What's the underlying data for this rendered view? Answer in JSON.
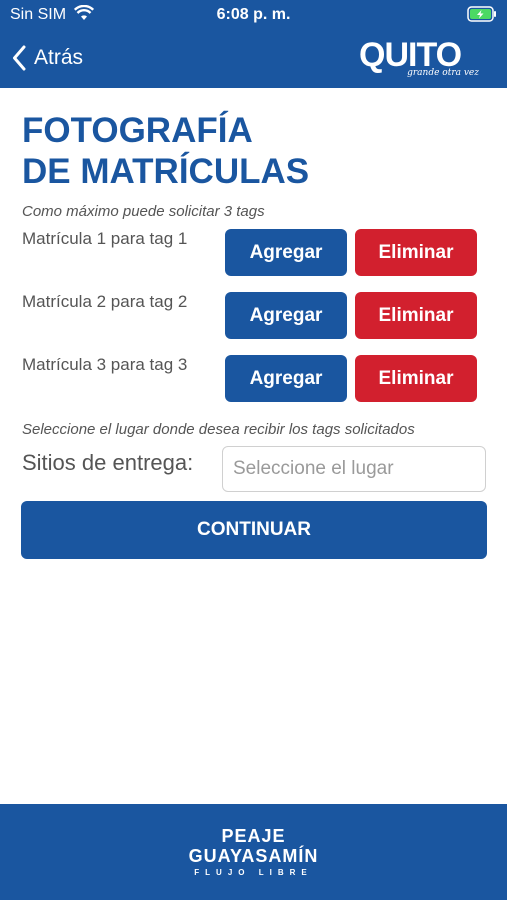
{
  "status_bar": {
    "carrier": "Sin SIM",
    "time": "6:08 p. m."
  },
  "nav": {
    "back_label": "Atrás"
  },
  "logo": {
    "word": "QUITO",
    "tagline": "grande otra vez"
  },
  "page": {
    "title_line1": "FOTOGRAFÍA",
    "title_line2": "DE MATRÍCULAS",
    "limit_note": "Como máximo puede solicitar 3 tags"
  },
  "plates": [
    {
      "label": "Matrícula 1 para tag 1",
      "add": "Agregar",
      "remove": "Eliminar"
    },
    {
      "label": "Matrícula 2 para tag 2",
      "add": "Agregar",
      "remove": "Eliminar"
    },
    {
      "label": "Matrícula 3 para tag 3",
      "add": "Agregar",
      "remove": "Eliminar"
    }
  ],
  "delivery": {
    "note": "Seleccione el lugar donde desea recibir los tags solicitados",
    "label": "Sitios de entrega:",
    "placeholder": "Seleccione el lugar",
    "value": ""
  },
  "continue_label": "CONTINUAR",
  "footer": {
    "line1": "PEAJE",
    "line2": "GUAYASAMÍN",
    "line3": "FLUJO LIBRE"
  },
  "colors": {
    "primary": "#1a56a0",
    "danger": "#d2202e",
    "battery": "#4cd964"
  }
}
